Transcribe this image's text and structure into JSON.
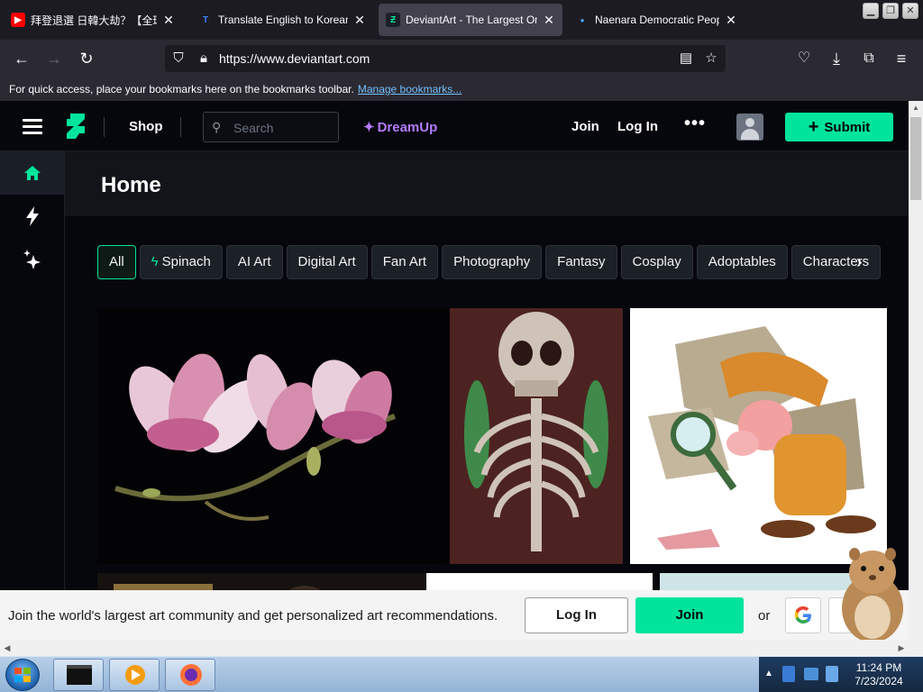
{
  "browser": {
    "tabs": [
      {
        "title": "拜登退選 日韓大劫？【全球",
        "favicon": "youtube-icon",
        "color": "#ff0000",
        "active": false
      },
      {
        "title": "Translate English to Korean",
        "favicon": "translate-icon",
        "color": "#3b82f6",
        "active": false
      },
      {
        "title": "DeviantArt - The Largest Onl",
        "favicon": "deviantart-icon",
        "color": "#00e59b",
        "active": true
      },
      {
        "title": "Naenara Democratic People",
        "favicon": "globe-icon",
        "color": "#4aa3ff",
        "active": false
      }
    ],
    "url": "https://www.deviantart.com",
    "bookmarks_message": "For quick access, place your bookmarks here on the bookmarks toolbar.",
    "bookmarks_link": "Manage bookmarks..."
  },
  "header": {
    "shop": "Shop",
    "search_placeholder": "Search",
    "dreamup": "DreamUp",
    "join": "Join",
    "login": "Log In",
    "more": "•••",
    "submit": "Submit"
  },
  "rail": [
    {
      "icon": "home-icon",
      "active": true
    },
    {
      "icon": "lightning-icon",
      "active": false
    },
    {
      "icon": "dreamup-sparkle-icon",
      "active": false
    }
  ],
  "page": {
    "title": "Home",
    "chips": [
      {
        "label": "All",
        "selected": true
      },
      {
        "label": "Spinach",
        "icon": "lightning-icon"
      },
      {
        "label": "AI Art"
      },
      {
        "label": "Digital Art"
      },
      {
        "label": "Fan Art"
      },
      {
        "label": "Photography"
      },
      {
        "label": "Fantasy"
      },
      {
        "label": "Cosplay"
      },
      {
        "label": "Adoptables"
      },
      {
        "label": "Characters"
      }
    ]
  },
  "artworks": [
    {
      "subject": "magnolia-painting"
    },
    {
      "subject": "skeleton-painting"
    },
    {
      "subject": "detective-cartoon"
    }
  ],
  "banner": {
    "message": "Join the world's largest art community and get personalized art recommendations.",
    "login": "Log In",
    "join": "Join",
    "or": "or"
  },
  "taskbar": {
    "time": "11:24 PM",
    "date": "7/23/2024"
  },
  "colors": {
    "accent": "#00e59b",
    "dreamup": "#b57bff",
    "background": "#06070d"
  }
}
